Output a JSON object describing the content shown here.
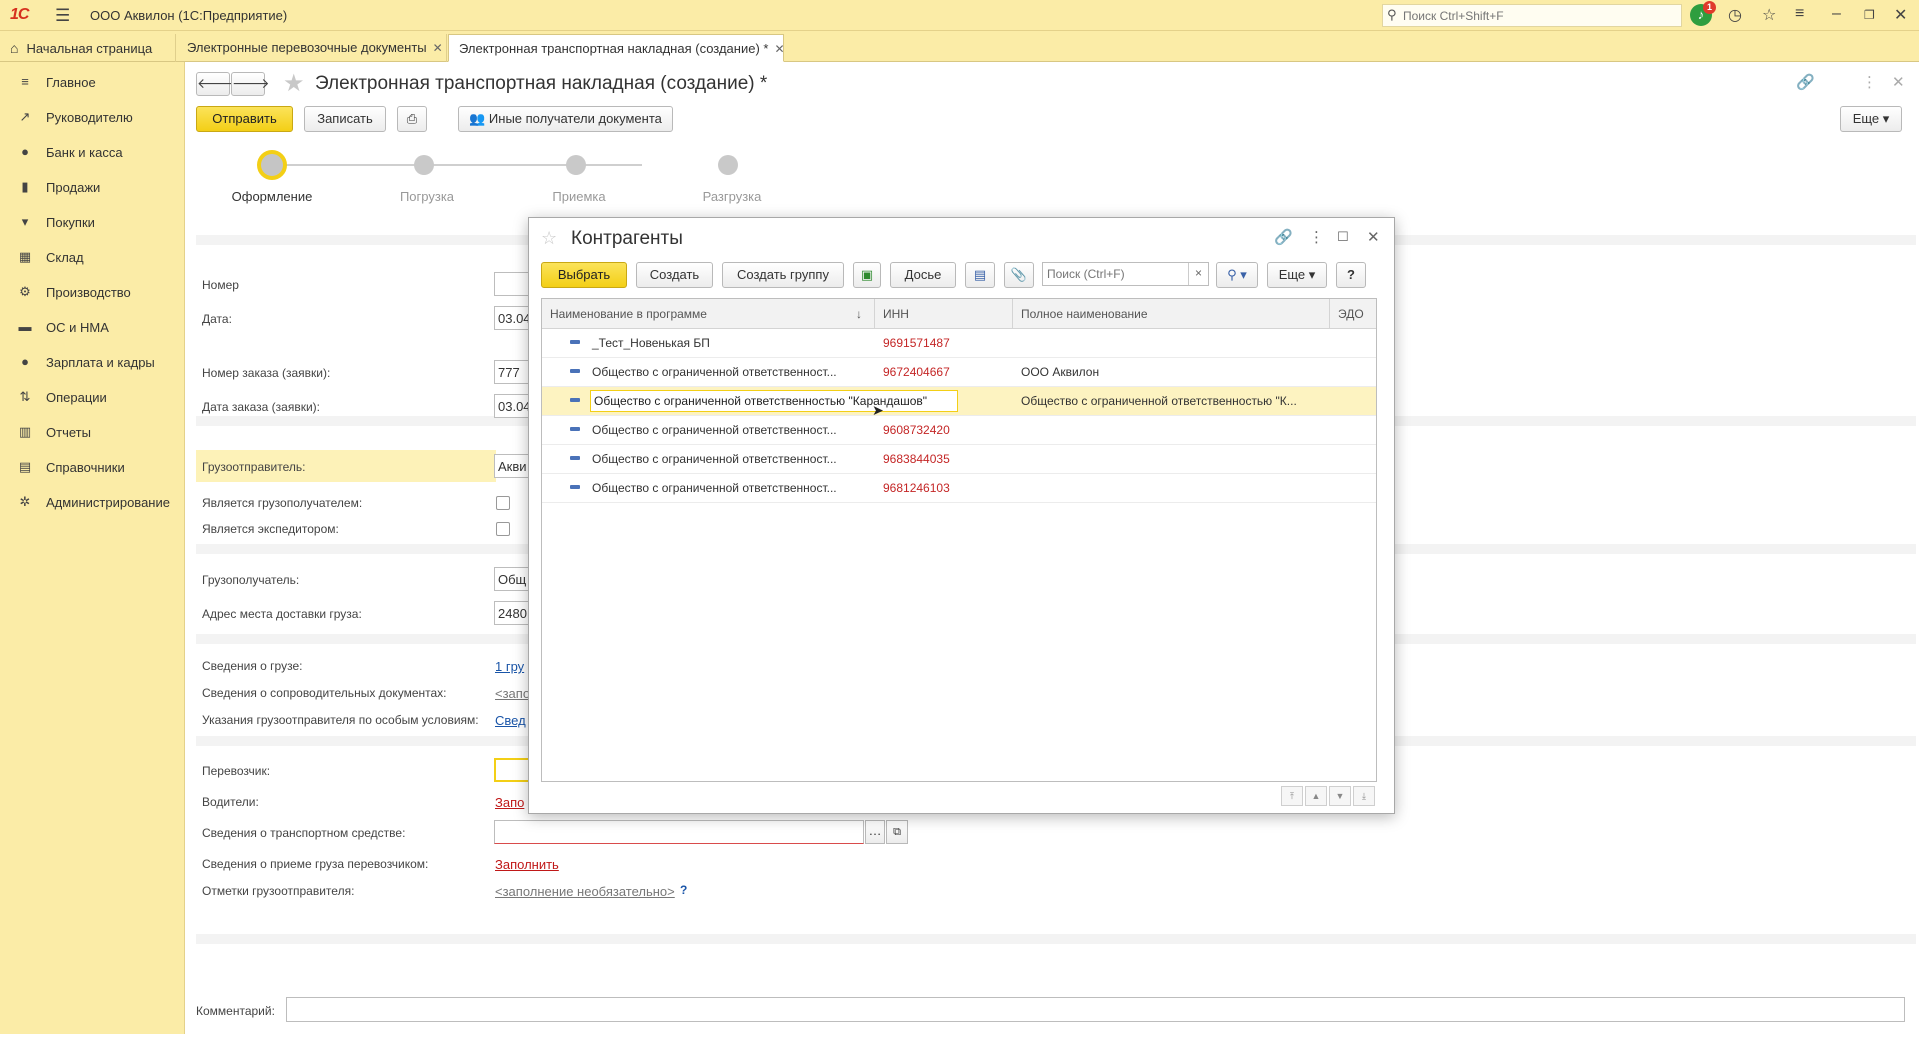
{
  "titlebar": {
    "app_title": "ООО Аквилон  (1С:Предприятие)",
    "search_placeholder": "Поиск Ctrl+Shift+F",
    "notification_count": "1"
  },
  "tabs": [
    {
      "label": "Начальная страница"
    },
    {
      "label": "Электронные перевозочные документы"
    },
    {
      "label": "Электронная транспортная накладная (создание) *"
    }
  ],
  "sidebar": {
    "items": [
      {
        "label": "Главное",
        "icon": "≡"
      },
      {
        "label": "Руководителю",
        "icon": "↗"
      },
      {
        "label": "Банк и касса",
        "icon": "●"
      },
      {
        "label": "Продажи",
        "icon": "▮"
      },
      {
        "label": "Покупки",
        "icon": "▾"
      },
      {
        "label": "Склад",
        "icon": "▦"
      },
      {
        "label": "Производство",
        "icon": "⚙"
      },
      {
        "label": "ОС и НМА",
        "icon": "▬"
      },
      {
        "label": "Зарплата и кадры",
        "icon": "●"
      },
      {
        "label": "Операции",
        "icon": "⇅"
      },
      {
        "label": "Отчеты",
        "icon": "▥"
      },
      {
        "label": "Справочники",
        "icon": "▤"
      },
      {
        "label": "Администрирование",
        "icon": "✲"
      }
    ]
  },
  "form": {
    "title": "Электронная транспортная накладная (создание) *",
    "send_button": "Отправить",
    "save_button": "Записать",
    "recipients_button": "Иные получатели документа",
    "more_button": "Еще",
    "steps": [
      {
        "label": "Оформление",
        "active": true
      },
      {
        "label": "Погрузка",
        "active": false
      },
      {
        "label": "Приемка",
        "active": false
      },
      {
        "label": "Разгрузка",
        "active": false
      }
    ],
    "fields": {
      "number_label": "Номер",
      "number_value": "",
      "date_label": "Дата:",
      "date_value": "03.04",
      "order_number_label": "Номер заказа (заявки):",
      "order_number_value": "777",
      "order_date_label": "Дата заказа (заявки):",
      "order_date_value": "03.04",
      "shipper_label": "Грузоотправитель:",
      "shipper_value": "Акви",
      "is_consignee_label": "Является грузополучателем:",
      "is_forwarder_label": "Является экспедитором:",
      "consignee_label": "Грузополучатель:",
      "consignee_value": "Общ",
      "delivery_address_label": "Адрес места доставки груза:",
      "delivery_address_value": "2480",
      "cargo_info_label": "Сведения о грузе:",
      "cargo_info_value": "1 гру",
      "accompanying_docs_label": "Сведения о сопроводительных документах:",
      "accompanying_docs_value": "<запо",
      "special_conditions_label": "Указания грузоотправителя по особым условиям:",
      "special_conditions_value": "Свед",
      "carrier_label": "Перевозчик:",
      "drivers_label": "Водители:",
      "drivers_value": "Запо",
      "vehicle_label": "Сведения о транспортном средстве:",
      "acceptance_label": "Сведения о приеме груза перевозчиком:",
      "acceptance_value": "Заполнить",
      "shipper_marks_label": "Отметки грузоотправителя:",
      "shipper_marks_value": "<заполнение необязательно>",
      "help_mark": "?",
      "comment_label": "Комментарий:"
    }
  },
  "dialog": {
    "title": "Контрагенты",
    "toolbar": {
      "select": "Выбрать",
      "create": "Создать",
      "create_group": "Создать группу",
      "dossier": "Досье",
      "search_placeholder": "Поиск (Ctrl+F)",
      "clear": "×",
      "more": "Еще",
      "help": "?"
    },
    "columns": [
      "Наименование в программе",
      "ИНН",
      "Полное наименование",
      "ЭДО"
    ],
    "sort_indicator": "↓",
    "rows": [
      {
        "name": "_Тест_Новенькая БП",
        "inn": "9691571487",
        "full_name": "",
        "edo": ""
      },
      {
        "name": "Общество с ограниченной ответственност...",
        "inn": "9672404667",
        "full_name": "ООО Аквилон",
        "edo": ""
      },
      {
        "name": "Общество с ограниченной ответственностью \"Карандашов\"",
        "inn": "",
        "full_name": "Общество с ограниченной ответственностью \"К...",
        "edo": ""
      },
      {
        "name": "Общество с ограниченной ответственност...",
        "inn": "9608732420",
        "full_name": "",
        "edo": ""
      },
      {
        "name": "Общество с ограниченной ответственност...",
        "inn": "9683844035",
        "full_name": "",
        "edo": ""
      },
      {
        "name": "Общество с ограниченной ответственност...",
        "inn": "9681246103",
        "full_name": "",
        "edo": ""
      }
    ]
  }
}
